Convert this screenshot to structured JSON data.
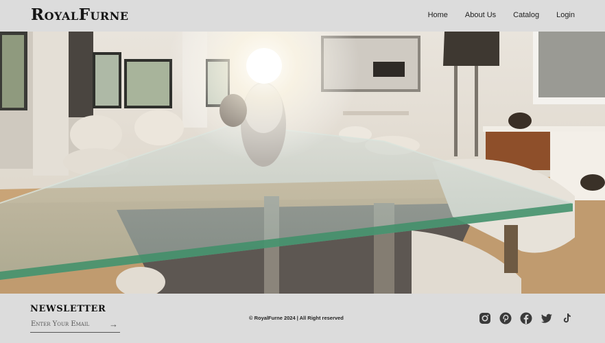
{
  "brand": {
    "logo": "RoyalFurne"
  },
  "nav": {
    "items": [
      {
        "label": "Home"
      },
      {
        "label": "About Us"
      },
      {
        "label": "Catalog"
      },
      {
        "label": "Login"
      }
    ]
  },
  "footer": {
    "newsletter_title": "NEWSLETTER",
    "email_placeholder": "Enter Your Email",
    "copyright": "© RoyalFurne 2024 | All Right reserved",
    "socials": [
      {
        "icon": "instagram-icon"
      },
      {
        "icon": "pinterest-icon"
      },
      {
        "icon": "facebook-icon"
      },
      {
        "icon": "twitter-icon"
      },
      {
        "icon": "tiktok-icon"
      }
    ]
  },
  "colors": {
    "background": "#dcdcdc",
    "text": "#1a1a1a",
    "icon": "#3a3a3a"
  }
}
